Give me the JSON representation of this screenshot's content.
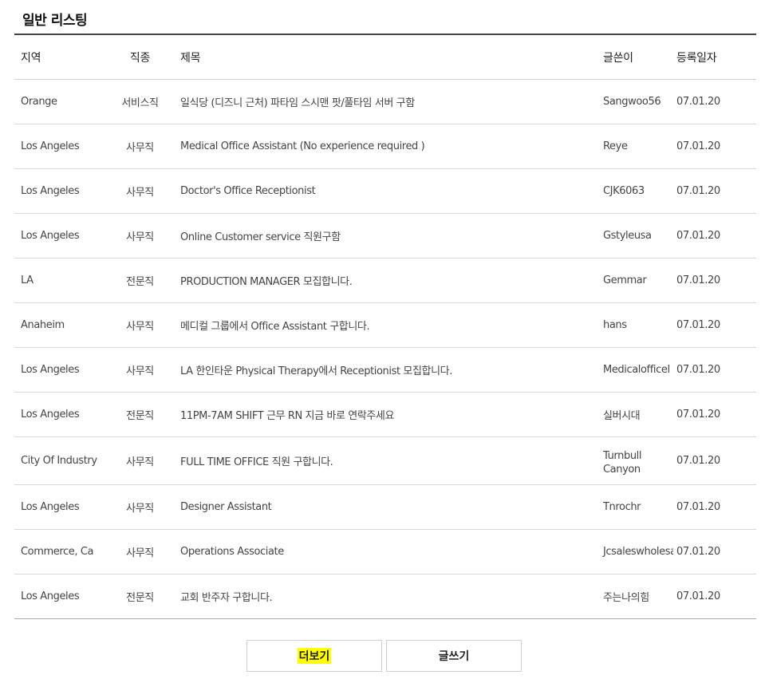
{
  "section": {
    "title": "일반 리스팅"
  },
  "table": {
    "headers": {
      "region": "지역",
      "category": "직종",
      "title": "제목",
      "author": "글쓴이",
      "date": "등록일자"
    },
    "rows": [
      {
        "region": "Orange",
        "category": "서비스직",
        "title": "일식당 (디즈니 근처) 파타임 스시맨 팟/풀타임 서버 구함",
        "author": "Sangwoo56",
        "date": "07.01.20"
      },
      {
        "region": "Los Angeles",
        "category": "사무직",
        "title": "Medical Office Assistant (No experience required )",
        "author": "Reye",
        "date": "07.01.20"
      },
      {
        "region": "Los Angeles",
        "category": "사무직",
        "title": "Doctor's Office Receptionist",
        "author": "CJK6063",
        "date": "07.01.20"
      },
      {
        "region": "Los Angeles",
        "category": "사무직",
        "title": "Online Customer service 직원구함",
        "author": "Gstyleusa",
        "date": "07.01.20"
      },
      {
        "region": "LA",
        "category": "전문직",
        "title": "PRODUCTION MANAGER 모집합니다.",
        "author": "Gemmar",
        "date": "07.01.20"
      },
      {
        "region": "Anaheim",
        "category": "사무직",
        "title": "메디컬 그룹에서 Office Assistant 구합니다.",
        "author": "hans",
        "date": "07.01.20"
      },
      {
        "region": "Los Angeles",
        "category": "사무직",
        "title": "LA 한인타운 Physical Therapy에서 Receptionist 모집합니다.",
        "author": "Medicalofficel",
        "date": "07.01.20"
      },
      {
        "region": "Los Angeles",
        "category": "전문직",
        "title": "11PM-7AM SHIFT 근무 RN 지금 바로 연락주세요",
        "author": "실버시대",
        "date": "07.01.20"
      },
      {
        "region": "City Of Industry",
        "category": "사무직",
        "title": "FULL TIME OFFICE 직원 구합니다.",
        "author": "Turnbull Canyon",
        "date": "07.01.20"
      },
      {
        "region": "Los Angeles",
        "category": "사무직",
        "title": "Designer Assistant",
        "author": "Tnrochr",
        "date": "07.01.20"
      },
      {
        "region": "Commerce, Ca",
        "category": "사무직",
        "title": "Operations Associate",
        "author": "Jcsaleswholesa",
        "date": "07.01.20"
      },
      {
        "region": "Los Angeles",
        "category": "전문직",
        "title": "교회 반주자 구합니다.",
        "author": "주는나의힘",
        "date": "07.01.20"
      }
    ]
  },
  "buttons": {
    "more": "더보기",
    "write": "글쓰기"
  },
  "colors": {
    "highlight": "#ffff00",
    "rule": "#444444"
  }
}
